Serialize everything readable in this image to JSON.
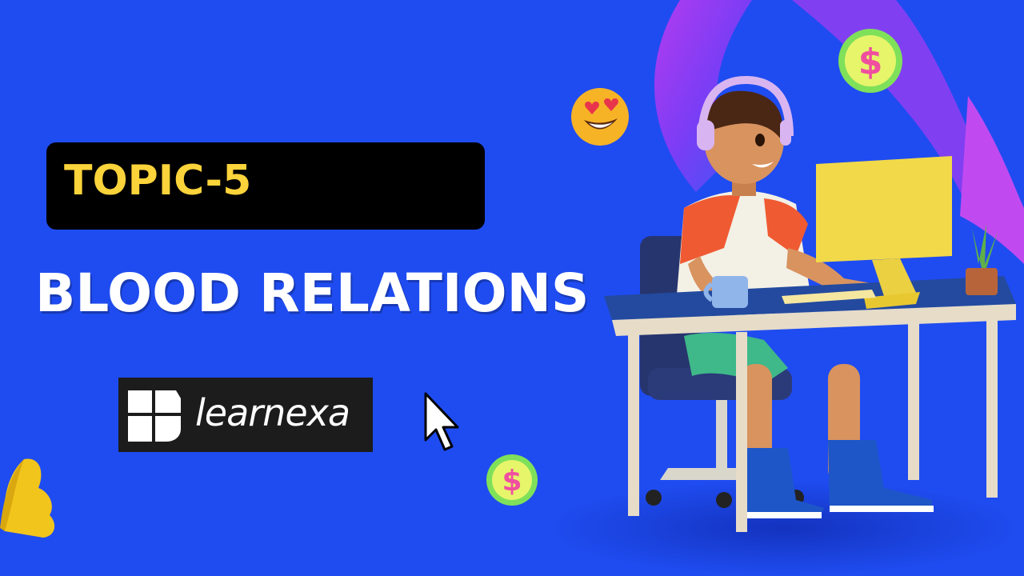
{
  "slide": {
    "topic_label": "TOPIC-5",
    "title": "BLOOD RELATIONS"
  },
  "brand": {
    "name": "learnexa"
  },
  "colors": {
    "background": "#1f4cf0",
    "topic_bar": "#000000",
    "topic_text": "#fbd33a",
    "title_text": "#ffffff",
    "logo_bg": "#1c1c1c"
  },
  "icons": {
    "cursor": "pointer-cursor-icon",
    "coin": "dollar-coin-icon",
    "emoji": "heart-eyes-emoji-icon",
    "logo": "learnexa-logo-mark"
  }
}
